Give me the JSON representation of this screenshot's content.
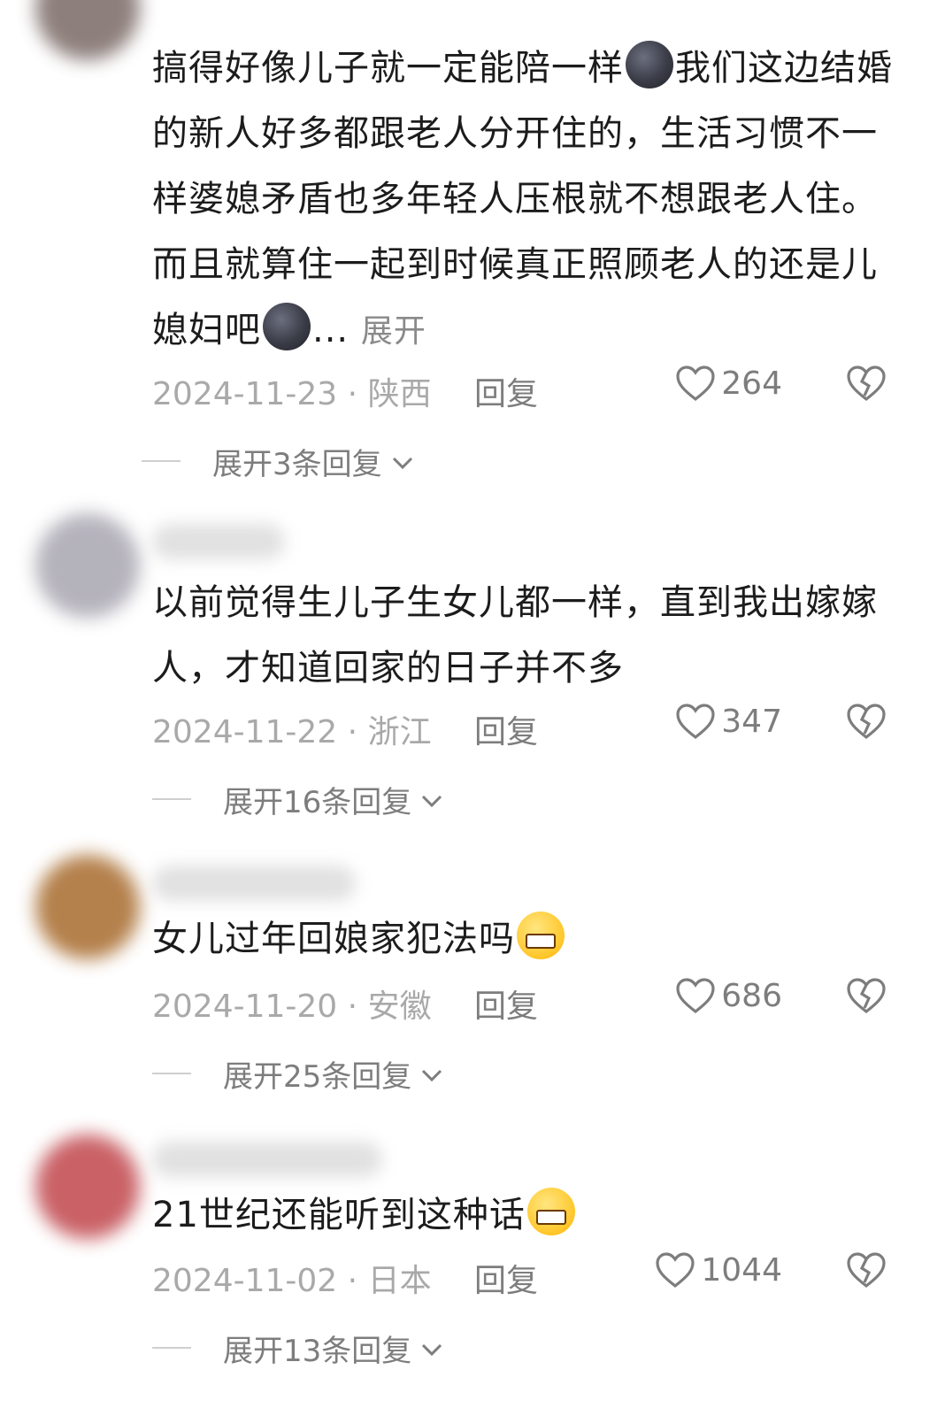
{
  "comments": [
    {
      "text_parts": [
        "搞得好像儿子就一定能陪一样",
        "我们这边结婚的新人好多都跟老人分开住的，生活习惯不一样婆媳矛盾也多年轻人压根就不想跟老人住。而且就算住一起到时候真正照顾老人的还是儿媳妇吧",
        "..."
      ],
      "emoji": "moon-face-emoji",
      "expand_label": "展开",
      "date": "2024-11-23",
      "location": "陕西",
      "reply_label": "回复",
      "likes": "264",
      "expand_replies": "展开3条回复"
    },
    {
      "text": "以前觉得生儿子生女儿都一样，直到我出嫁嫁人，才知道回家的日子并不多",
      "date": "2024-11-22",
      "location": "浙江",
      "reply_label": "回复",
      "likes": "347",
      "expand_replies": "展开16条回复"
    },
    {
      "text": "女儿过年回娘家犯法吗",
      "emoji": "grinning-sweat-emoji",
      "date": "2024-11-20",
      "location": "安徽",
      "reply_label": "回复",
      "likes": "686",
      "expand_replies": "展开25条回复"
    },
    {
      "text": "21世纪还能听到这种话",
      "emoji": "grinning-sweat-emoji",
      "date": "2024-11-02",
      "location": "日本",
      "reply_label": "回复",
      "likes": "1044",
      "expand_replies": "展开13条回复"
    }
  ],
  "meta_separator": "·",
  "icons": {
    "like": "heart-outline-icon",
    "dislike": "broken-heart-icon",
    "expand": "chevron-down-icon"
  },
  "colors": {
    "text": "#1c1c1c",
    "meta": "#a9a9a9",
    "action": "#7d7d7d"
  }
}
